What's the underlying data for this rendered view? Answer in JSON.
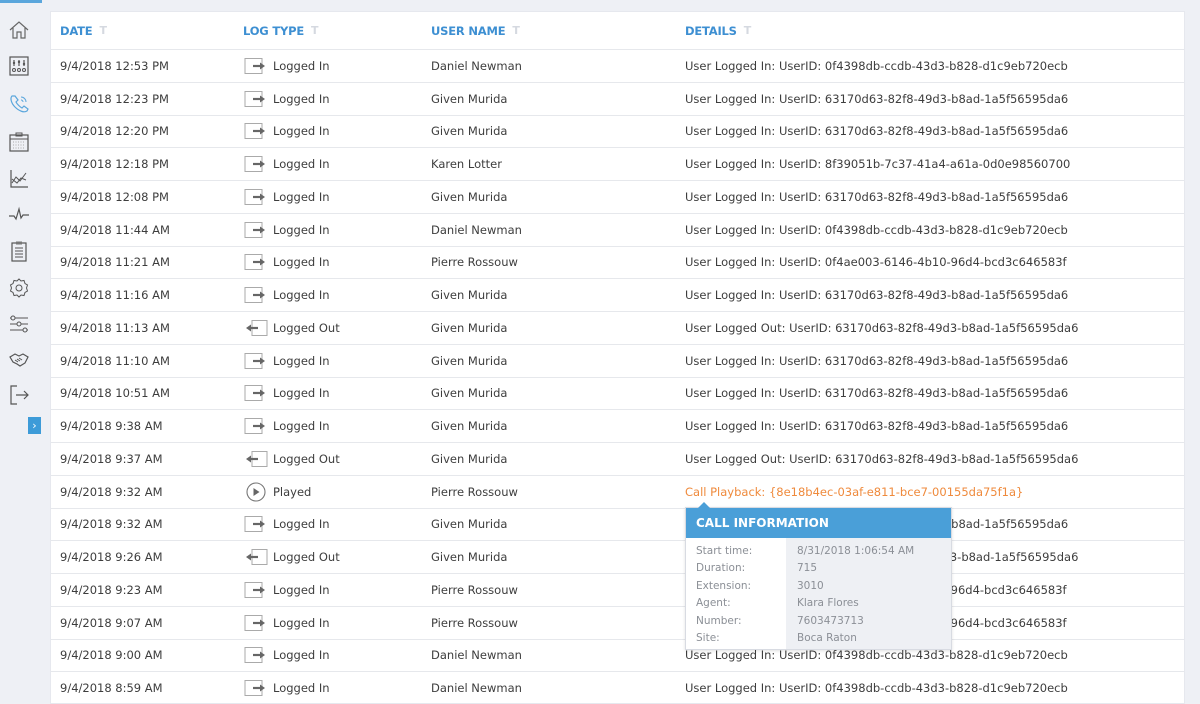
{
  "sidebar": {
    "items": [
      {
        "name": "home",
        "icon": "home-icon"
      },
      {
        "name": "dashboard",
        "icon": "mixer-panel-icon"
      },
      {
        "name": "calls",
        "icon": "phone-icon",
        "active": true
      },
      {
        "name": "calendar",
        "icon": "calendar-icon"
      },
      {
        "name": "reports",
        "icon": "line-chart-icon"
      },
      {
        "name": "activity",
        "icon": "pulse-icon"
      },
      {
        "name": "tasks",
        "icon": "clipboard-icon"
      },
      {
        "name": "settings",
        "icon": "gear-icon"
      },
      {
        "name": "filters",
        "icon": "sliders-icon"
      },
      {
        "name": "partners",
        "icon": "handshake-icon"
      },
      {
        "name": "logout",
        "icon": "exit-icon"
      }
    ],
    "expand_label": "›"
  },
  "colors": {
    "accent": "#3d8fd2",
    "link": "#ef8a3c",
    "popup_header": "#4a9fd8"
  },
  "table": {
    "columns": [
      "DATE",
      "LOG TYPE",
      "USER NAME",
      "DETAILS"
    ],
    "filter_glyph": "T",
    "rows": [
      {
        "date": "9/4/2018 12:53 PM",
        "type": "Logged In",
        "icon": "login",
        "user": "Daniel Newman",
        "details": "User Logged In: UserID: 0f4398db-ccdb-43d3-b828-d1c9eb720ecb"
      },
      {
        "date": "9/4/2018 12:23 PM",
        "type": "Logged In",
        "icon": "login",
        "user": "Given Murida",
        "details": "User Logged In: UserID: 63170d63-82f8-49d3-b8ad-1a5f56595da6"
      },
      {
        "date": "9/4/2018 12:20 PM",
        "type": "Logged In",
        "icon": "login",
        "user": "Given Murida",
        "details": "User Logged In: UserID: 63170d63-82f8-49d3-b8ad-1a5f56595da6"
      },
      {
        "date": "9/4/2018 12:18 PM",
        "type": "Logged In",
        "icon": "login",
        "user": "Karen Lotter",
        "details": "User Logged In: UserID: 8f39051b-7c37-41a4-a61a-0d0e98560700"
      },
      {
        "date": "9/4/2018 12:08 PM",
        "type": "Logged In",
        "icon": "login",
        "user": "Given Murida",
        "details": "User Logged In: UserID: 63170d63-82f8-49d3-b8ad-1a5f56595da6"
      },
      {
        "date": "9/4/2018 11:44 AM",
        "type": "Logged In",
        "icon": "login",
        "user": "Daniel Newman",
        "details": "User Logged In: UserID: 0f4398db-ccdb-43d3-b828-d1c9eb720ecb"
      },
      {
        "date": "9/4/2018 11:21 AM",
        "type": "Logged In",
        "icon": "login",
        "user": "Pierre Rossouw",
        "details": "User Logged In: UserID: 0f4ae003-6146-4b10-96d4-bcd3c646583f"
      },
      {
        "date": "9/4/2018 11:16 AM",
        "type": "Logged In",
        "icon": "login",
        "user": "Given Murida",
        "details": "User Logged In: UserID: 63170d63-82f8-49d3-b8ad-1a5f56595da6"
      },
      {
        "date": "9/4/2018 11:13 AM",
        "type": "Logged Out",
        "icon": "logout",
        "user": "Given Murida",
        "details": "User Logged Out: UserID: 63170d63-82f8-49d3-b8ad-1a5f56595da6"
      },
      {
        "date": "9/4/2018 11:10 AM",
        "type": "Logged In",
        "icon": "login",
        "user": "Given Murida",
        "details": "User Logged In: UserID: 63170d63-82f8-49d3-b8ad-1a5f56595da6"
      },
      {
        "date": "9/4/2018 10:51 AM",
        "type": "Logged In",
        "icon": "login",
        "user": "Given Murida",
        "details": "User Logged In: UserID: 63170d63-82f8-49d3-b8ad-1a5f56595da6"
      },
      {
        "date": "9/4/2018 9:38 AM",
        "type": "Logged In",
        "icon": "login",
        "user": "Given Murida",
        "details": "User Logged In: UserID: 63170d63-82f8-49d3-b8ad-1a5f56595da6"
      },
      {
        "date": "9/4/2018 9:37 AM",
        "type": "Logged Out",
        "icon": "logout",
        "user": "Given Murida",
        "details": "User Logged Out: UserID: 63170d63-82f8-49d3-b8ad-1a5f56595da6"
      },
      {
        "date": "9/4/2018 9:32 AM",
        "type": "Played",
        "icon": "play",
        "user": "Pierre Rossouw",
        "details": "Call Playback: {8e18b4ec-03af-e811-bce7-00155da75f1a}",
        "link": true
      },
      {
        "date": "9/4/2018 9:32 AM",
        "type": "Logged In",
        "icon": "login",
        "user": "Given Murida",
        "details": "User Logged In: UserID: 63170d63-82f8-49d3-b8ad-1a5f56595da6"
      },
      {
        "date": "9/4/2018 9:26 AM",
        "type": "Logged Out",
        "icon": "logout",
        "user": "Given Murida",
        "details": "User Logged Out: UserID: 63170d63-82f8-49d3-b8ad-1a5f56595da6"
      },
      {
        "date": "9/4/2018 9:23 AM",
        "type": "Logged In",
        "icon": "login",
        "user": "Pierre Rossouw",
        "details": "User Logged In: UserID: 0f4ae003-6146-4b10-96d4-bcd3c646583f"
      },
      {
        "date": "9/4/2018 9:07 AM",
        "type": "Logged In",
        "icon": "login",
        "user": "Pierre Rossouw",
        "details": "User Logged In: UserID: 0f4ae003-6146-4b10-96d4-bcd3c646583f"
      },
      {
        "date": "9/4/2018 9:00 AM",
        "type": "Logged In",
        "icon": "login",
        "user": "Daniel Newman",
        "details": "User Logged In: UserID: 0f4398db-ccdb-43d3-b828-d1c9eb720ecb"
      },
      {
        "date": "9/4/2018 8:59 AM",
        "type": "Logged In",
        "icon": "login",
        "user": "Daniel Newman",
        "details": "User Logged In: UserID: 0f4398db-ccdb-43d3-b828-d1c9eb720ecb"
      }
    ]
  },
  "popup": {
    "title": "CALL INFORMATION",
    "fields": [
      {
        "label": "Start time:",
        "value": "8/31/2018  1:06:54 AM"
      },
      {
        "label": "Duration:",
        "value": "715"
      },
      {
        "label": "Extension:",
        "value": "3010"
      },
      {
        "label": "Agent:",
        "value": "Klara Flores"
      },
      {
        "label": "Number:",
        "value": "7603473713"
      },
      {
        "label": "Site:",
        "value": "Boca Raton"
      }
    ]
  }
}
